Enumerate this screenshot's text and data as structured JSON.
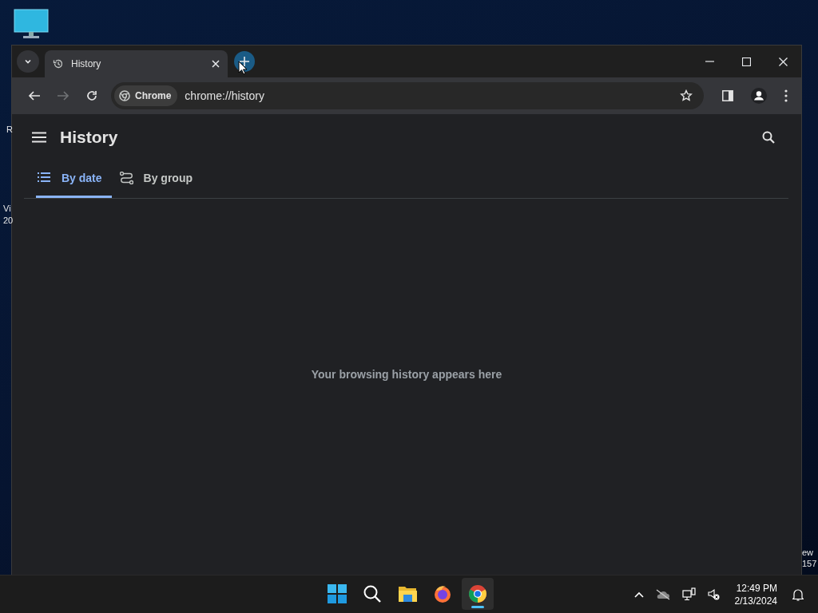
{
  "desktop": {
    "left_edge_text": [
      "R",
      "Vi",
      "20"
    ],
    "right_edge_text": [
      "ew",
      "157"
    ]
  },
  "browser": {
    "tabs": [
      {
        "title": "History",
        "selected": true
      }
    ],
    "toolbar_buttons": [
      {
        "kind": "back",
        "disabled": false
      },
      {
        "kind": "forward",
        "disabled": true
      },
      {
        "kind": "reload",
        "disabled": false
      }
    ],
    "address": {
      "chip": "Chrome",
      "url": "chrome://history"
    },
    "page": {
      "title": "History",
      "tabs": [
        {
          "kind": "date",
          "label": "By date",
          "selected": true
        },
        {
          "kind": "group",
          "label": "By group",
          "selected": false
        }
      ],
      "empty_message": "Your browsing history appears here"
    }
  },
  "taskbar": {
    "apps": [
      {
        "kind": "start",
        "active": false
      },
      {
        "kind": "search",
        "active": false
      },
      {
        "kind": "files",
        "active": false
      },
      {
        "kind": "firefox",
        "active": false
      },
      {
        "kind": "chrome",
        "active": true
      }
    ],
    "clock": {
      "time": "12:49 PM",
      "date": "2/13/2024"
    }
  }
}
